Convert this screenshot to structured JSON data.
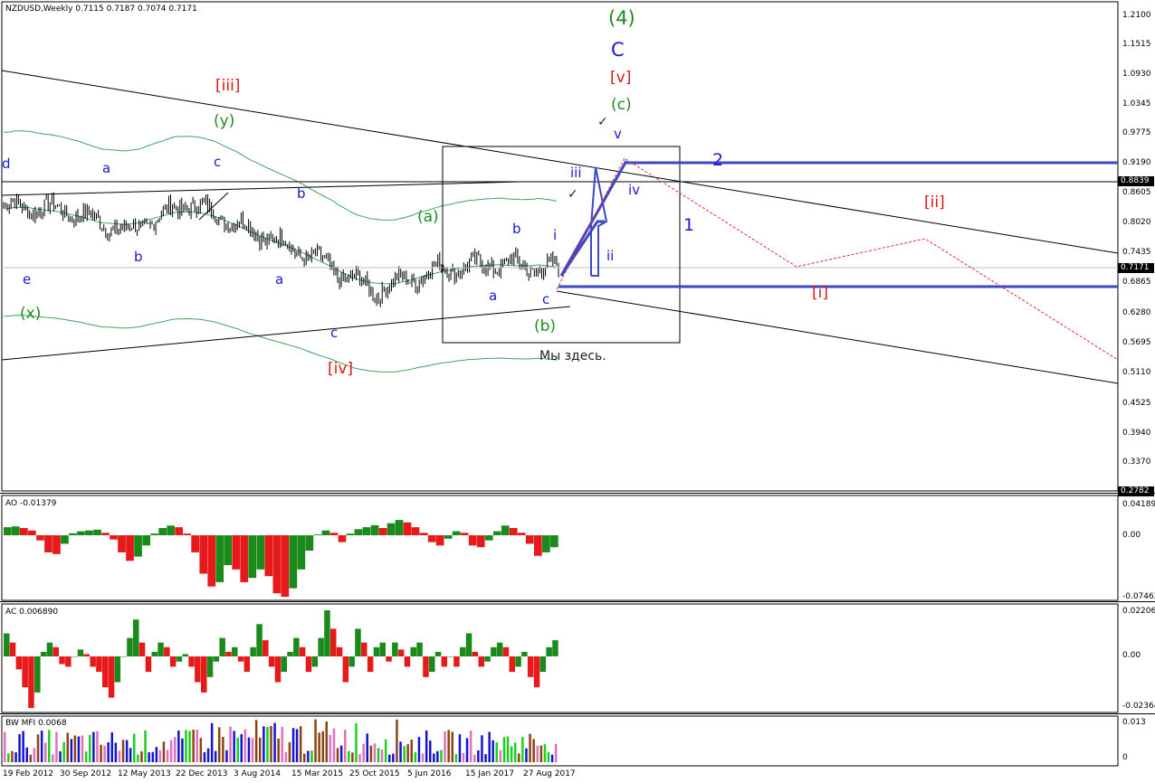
{
  "chart_header": {
    "title": "NZDUSD,Weekly  0.7115 0.7187 0.7074 0.7171"
  },
  "colors": {
    "price_candle": "#000000",
    "ao_up": "#1a8a1a",
    "ao_down": "#e61a1a",
    "envelope": "#3aa55a",
    "channel": "#000000",
    "wave_blue": "#3b48c8",
    "forecast_red": "#e03030",
    "mfi_blue": "#1414d0",
    "mfi_green": "#1bd01b",
    "mfi_brown": "#8b4513",
    "mfi_pink": "#e070c0"
  },
  "chart_data": [
    {
      "type": "line",
      "series": [
        {
          "name": "",
          "x": [
            "19 Feb 2012",
            "30 Sep 2012",
            "12 May 2013",
            "22 Dec 2013",
            "3 Aug 2014",
            "15 Mar 2015",
            "25 Oct 2015",
            "5 Jun 2016",
            "15 Jan 2017",
            "27 Aug 2017"
          ],
          "y": [
            0.835,
            0.829,
            0.785,
            0.842,
            0.79,
            0.736,
            0.67,
            0.712,
            0.724,
            0.712
          ]
        }
      ],
      "ylim": [
        0.2782,
        1.23
      ],
      "y_ticks": [
        "1.2100",
        "1.1515",
        "1.0930",
        "1.0345",
        "0.9775",
        "0.9190",
        "0.8839",
        "0.8605",
        "0.8020",
        "0.7435",
        "0.7171",
        "0.6865",
        "0.6280",
        "0.5695",
        "0.5110",
        "0.4525",
        "0.3940",
        "0.3370",
        "0.2782"
      ],
      "x_ticks": [
        "19 Feb 2012",
        "30 Sep 2012",
        "12 May 2013",
        "22 Dec 2013",
        "3 Aug 2014",
        "15 Mar 2015",
        "25 Oct 2015",
        "5 Jun 2016",
        "15 Jan 2017",
        "27 Aug 2017"
      ],
      "horizontal_lines": [
        0.8839,
        0.7171
      ],
      "grid": false
    },
    {
      "type": "bar",
      "title": "AO -0.01379",
      "ylim": [
        -0.07462,
        0.04189
      ],
      "y_ticks": [
        "0.04189",
        "0.00",
        "-0.07462"
      ],
      "values": [
        0.02,
        0.022,
        0.018,
        0.012,
        -0.006,
        -0.02,
        -0.022,
        -0.01,
        0.005,
        0.01,
        0.012,
        0.014,
        0.006,
        -0.005,
        -0.02,
        -0.03,
        -0.025,
        -0.012,
        0.004,
        0.018,
        0.024,
        0.02,
        0.004,
        -0.02,
        -0.045,
        -0.06,
        -0.055,
        -0.035,
        -0.04,
        -0.055,
        -0.05,
        -0.04,
        -0.048,
        -0.068,
        -0.072,
        -0.062,
        -0.04,
        -0.018,
        0.002,
        0.012,
        0.006,
        -0.008,
        0.004,
        0.015,
        0.02,
        0.025,
        0.018,
        0.03,
        0.038,
        0.032,
        0.02,
        0.006,
        -0.008,
        -0.012,
        -0.004,
        0.01,
        0.006,
        -0.012,
        -0.014,
        -0.006,
        0.01,
        0.024,
        0.018,
        0.006,
        -0.01,
        -0.024,
        -0.02,
        -0.014
      ]
    },
    {
      "type": "bar",
      "title": "AC 0.006890",
      "ylim": [
        -0.02364,
        0.02206
      ],
      "y_ticks": [
        "0.02206",
        "0.00",
        "-0.02364"
      ],
      "values": [
        0.01,
        0.006,
        -0.005,
        -0.012,
        -0.02,
        -0.014,
        0.002,
        0.006,
        0.004,
        -0.003,
        -0.004,
        0.0,
        0.003,
        0.001,
        -0.004,
        -0.006,
        -0.012,
        -0.016,
        -0.01,
        0.0,
        0.008,
        0.016,
        0.006,
        -0.006,
        0.002,
        0.006,
        0.004,
        -0.004,
        -0.002,
        0.001,
        -0.004,
        -0.01,
        -0.014,
        -0.008,
        -0.002,
        0.008,
        0.002,
        0.004,
        -0.002,
        -0.006,
        0.004,
        0.014,
        0.007,
        -0.004,
        -0.01,
        -0.006,
        0.002,
        0.008,
        0.004,
        -0.006,
        -0.004,
        0.008,
        0.02,
        0.012,
        0.004,
        -0.01,
        -0.004,
        0.012,
        0.006,
        -0.006,
        0.004,
        0.006,
        -0.002,
        0.006,
        0.003,
        -0.004,
        0.004,
        0.006,
        -0.008,
        -0.006,
        0.002,
        -0.004,
        0.0,
        -0.004,
        0.004,
        0.01,
        0.002,
        -0.004,
        -0.002,
        0.004,
        0.006,
        0.004,
        -0.006,
        -0.004,
        0.002,
        -0.008,
        -0.012,
        -0.006,
        0.004,
        0.007
      ]
    },
    {
      "type": "bar",
      "title": "BW MFI 0.0068",
      "ylim": [
        0,
        0.013
      ],
      "y_ticks": [
        "0.013",
        "0"
      ]
    }
  ],
  "wave_labels": {
    "four": "(4)",
    "C": "C",
    "v_red": "[v]",
    "c_green": "(c)",
    "v_blue": "v",
    "two": "2",
    "iii": "iii",
    "iv": "iv",
    "one": "1",
    "ii_red": "[ii]",
    "b1": "b",
    "i": "i",
    "ii": "ii",
    "a_green": "(a)",
    "a2": "a",
    "c2": "c",
    "i_red": "[i]",
    "b_green": "(b)",
    "here": "Мы здесь.",
    "iii_red": "[iii]",
    "y_green": "(y)",
    "d": "d",
    "a_top": "a",
    "c_top": "c",
    "b_top": "b",
    "b_low": "b",
    "e": "e",
    "x_green": "(x)",
    "a_mid": "a",
    "c_low": "c",
    "iv_red": "[iv]",
    "check": "✓"
  }
}
